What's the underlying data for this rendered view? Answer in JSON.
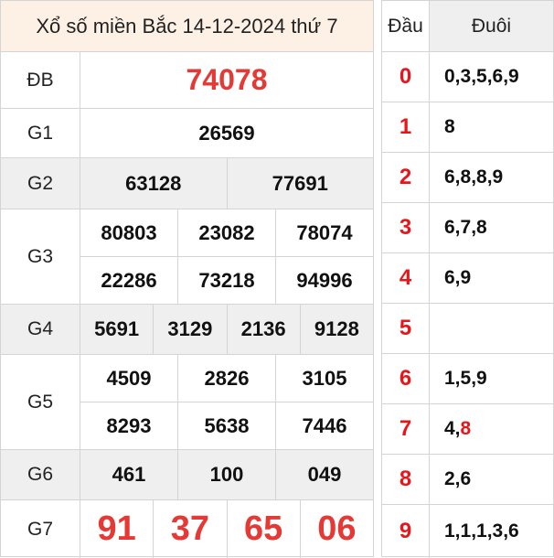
{
  "title": "Xổ số miền Bắc 14-12-2024 thứ 7",
  "prizes": {
    "db": {
      "label": "ĐB",
      "numbers": [
        "74078"
      ]
    },
    "g1": {
      "label": "G1",
      "numbers": [
        "26569"
      ]
    },
    "g2": {
      "label": "G2",
      "numbers": [
        "63128",
        "77691"
      ]
    },
    "g3": {
      "label": "G3",
      "numbers": [
        "80803",
        "23082",
        "78074",
        "22286",
        "73218",
        "94996"
      ]
    },
    "g4": {
      "label": "G4",
      "numbers": [
        "5691",
        "3129",
        "2136",
        "9128"
      ]
    },
    "g5": {
      "label": "G5",
      "numbers": [
        "4509",
        "2826",
        "3105",
        "8293",
        "5638",
        "7446"
      ]
    },
    "g6": {
      "label": "G6",
      "numbers": [
        "461",
        "100",
        "049"
      ]
    },
    "g7": {
      "label": "G7",
      "numbers": [
        "91",
        "37",
        "65",
        "06"
      ]
    }
  },
  "loto": {
    "head_dau": "Đầu",
    "head_duoi": "Đuôi",
    "rows": [
      {
        "dau": "0",
        "duoi": "0,3,5,6,9"
      },
      {
        "dau": "1",
        "duoi": "8"
      },
      {
        "dau": "2",
        "duoi": "6,8,8,9"
      },
      {
        "dau": "3",
        "duoi": "6,7,8"
      },
      {
        "dau": "4",
        "duoi": "6,9"
      },
      {
        "dau": "5",
        "duoi": ""
      },
      {
        "dau": "6",
        "duoi": "1,5,9"
      },
      {
        "dau": "7",
        "duoi": "4,",
        "duoi_highlight": "8"
      },
      {
        "dau": "8",
        "duoi": "2,6"
      },
      {
        "dau": "9",
        "duoi": "1,1,1,3,6"
      }
    ]
  },
  "colors": {
    "accent_red": "#e53935",
    "title_bg": "#fdf1e5",
    "stripe_bg": "#efefef"
  }
}
